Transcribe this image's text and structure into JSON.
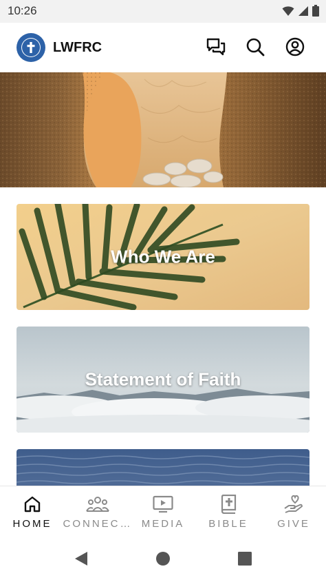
{
  "status_bar": {
    "time": "10:26",
    "icons": [
      "wifi-icon",
      "signal-icon",
      "battery-icon"
    ]
  },
  "header": {
    "title": "LWFRC",
    "logo_icon": "cross-logo-icon",
    "actions": [
      {
        "name": "chat-icon"
      },
      {
        "name": "search-icon"
      },
      {
        "name": "account-icon"
      }
    ]
  },
  "hero": {
    "image": "empty-tomb-banner"
  },
  "cards": [
    {
      "title": "Who We Are",
      "image": "palm-leaf-background"
    },
    {
      "title": "Statement of Faith",
      "image": "clouds-background"
    },
    {
      "title": "",
      "image": "ocean-background"
    }
  ],
  "bottom_nav": {
    "active": "HOME",
    "items": [
      {
        "label": "HOME",
        "icon": "home-icon"
      },
      {
        "label": "CONNEC…",
        "icon": "people-icon"
      },
      {
        "label": "MEDIA",
        "icon": "media-icon"
      },
      {
        "label": "BIBLE",
        "icon": "bible-icon"
      },
      {
        "label": "GIVE",
        "icon": "give-icon"
      }
    ]
  },
  "system_nav": {
    "buttons": [
      "back-icon",
      "home-circle-icon",
      "recents-icon"
    ]
  },
  "colors": {
    "brand": "#2d62a8",
    "active_nav": "#111111",
    "inactive_nav": "#8a8a8a",
    "status_bar_bg": "#f2f2f2"
  }
}
